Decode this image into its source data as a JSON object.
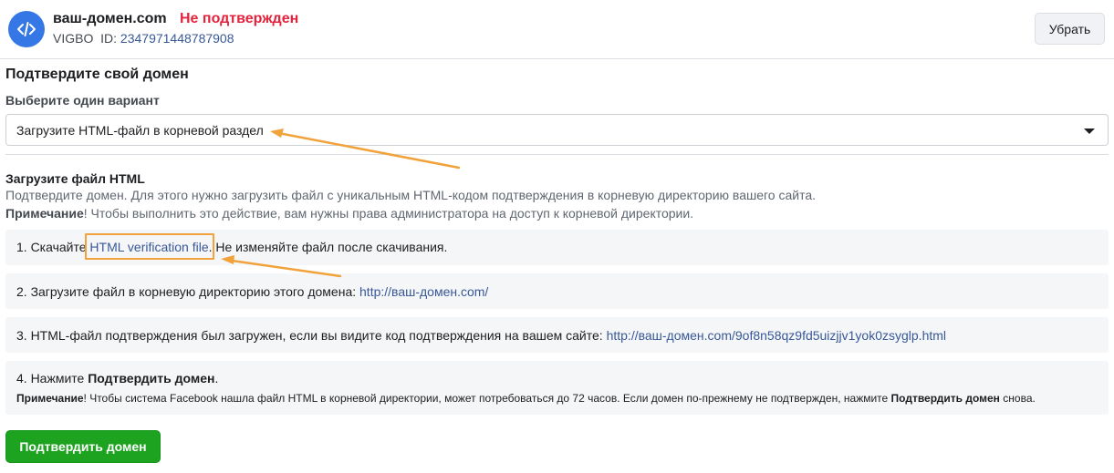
{
  "header": {
    "domain": "ваш-домен.com",
    "status": "Не подтвержден",
    "source": "VIGBO",
    "id_label": "ID:",
    "id_value": "2347971448787908",
    "remove_label": "Убрать",
    "avatar_icon": "code-icon"
  },
  "main": {
    "title": "Подтвердите свой домен",
    "choose_label": "Выберите один вариант",
    "select_value": "Загрузите HTML-файл в корневой раздел",
    "section_title": "Загрузите файл HTML",
    "description": "Подтвердите домен. Для этого нужно загрузить файл с уникальным HTML-кодом подтверждения в корневую директорию вашего сайта.",
    "note_label": "Примечание",
    "note_text": "! Чтобы выполнить это действие, вам нужны права администратора на доступ к корневой директории."
  },
  "steps": {
    "s1_prefix": "1. Скачайте ",
    "s1_link": "HTML verification file",
    "s1_suffix": ". Не изменяйте файл после скачивания.",
    "s2_prefix": "2. Загрузите файл в корневую директорию этого домена: ",
    "s2_link": "http://ваш-домен.com/",
    "s3_prefix": "3. HTML-файл подтверждения был загружен, если вы видите код подтверждения на вашем сайте: ",
    "s3_link": "http://ваш-домен.com/9of8n58qz9fd5uizjjv1yok0zsyglp.html",
    "s4_prefix": "4. Нажмите ",
    "s4_bold": "Подтвердить домен",
    "s4_suffix": ".",
    "s4_note_label": "Примечание",
    "s4_note_text": "! Чтобы система Facebook нашла файл HTML в корневой директории, может потребоваться до 72 часов. Если домен по-прежнему не подтвержден, нажмите ",
    "s4_note_bold": "Подтвердить домен",
    "s4_note_end": " снова."
  },
  "confirm_label": "Подтвердить домен",
  "colors": {
    "status_red": "#e4233c",
    "link_blue": "#385898",
    "confirm_green": "#1da320",
    "annotation_orange": "#f2a23a"
  }
}
